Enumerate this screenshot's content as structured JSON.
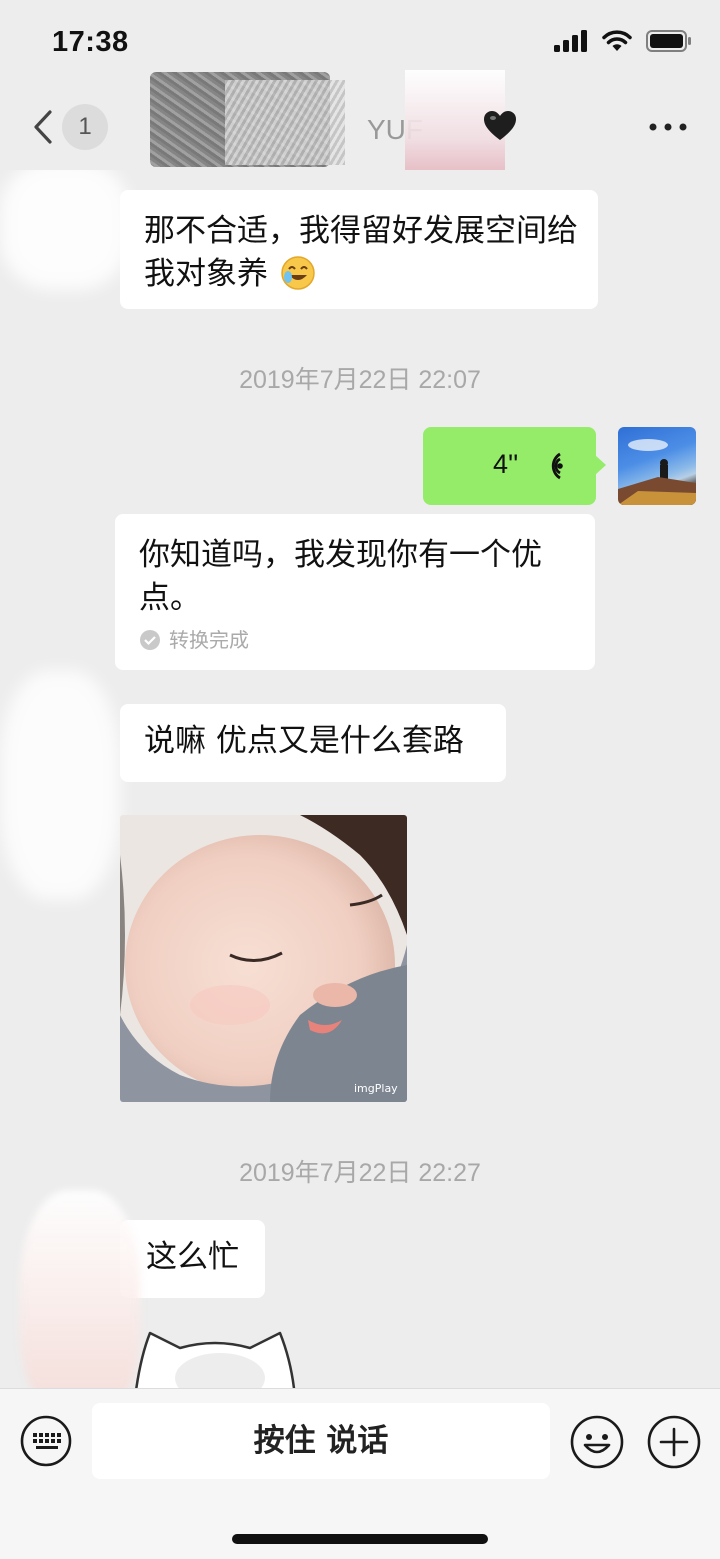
{
  "status_bar": {
    "time": "17:38"
  },
  "nav": {
    "unread_count": "1",
    "title_visible": "YUF"
  },
  "messages": {
    "m1": "那不合适，我得留好发展空间给我对象养",
    "timestamp1": "2019年7月22日 22:07",
    "voice_duration": "4''",
    "m2": "你知道吗，我发现你有一个优点。",
    "transcribe_status": "转换完成",
    "m3": "说嘛 优点又是什么套路",
    "image_watermark": "imgPlay",
    "timestamp2": "2019年7月22日 22:27",
    "m4": "这么忙"
  },
  "input": {
    "hold_to_talk_label": "按住 说话"
  },
  "icons": {
    "back": "chevron-left-icon",
    "more": "more-icon",
    "heart": "black-heart-icon",
    "voice": "voice-wave-icon",
    "keyboard": "keyboard-icon",
    "emoji": "emoji-icon",
    "plus": "plus-icon",
    "check": "check-icon"
  },
  "colors": {
    "outgoing_bubble": "#95ec69",
    "incoming_bubble": "#ffffff",
    "background": "#ededed"
  }
}
